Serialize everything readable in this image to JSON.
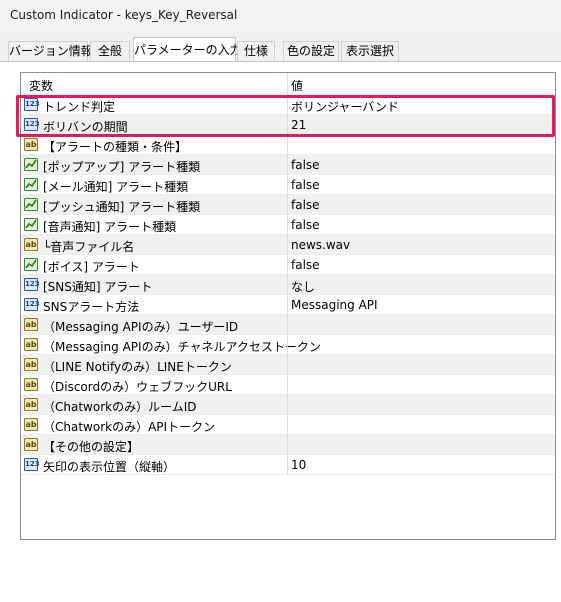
{
  "window": {
    "title": "Custom Indicator - keys_Key_Reversal"
  },
  "tabs": [
    {
      "label": "バージョン情報"
    },
    {
      "label": "全般"
    },
    {
      "label": "パラメーターの入力"
    },
    {
      "label": "仕様"
    },
    {
      "label": "色の設定"
    },
    {
      "label": "表示選択"
    }
  ],
  "grid": {
    "col_variable": "変数",
    "col_value": "値",
    "rows": [
      {
        "icon": "123",
        "type": "num",
        "name": "トレンド判定",
        "value": "ボリンジャーバンド"
      },
      {
        "icon": "123",
        "type": "num",
        "name": "ボリバンの期間",
        "value": "21"
      },
      {
        "icon": "ab",
        "type": "str",
        "name": "【アラートの種類・条件】",
        "value": ""
      },
      {
        "icon": "bool",
        "type": "bool",
        "name": "[ポップアップ] アラート種類",
        "value": "false"
      },
      {
        "icon": "bool",
        "type": "bool",
        "name": "[メール通知] アラート種類",
        "value": "false"
      },
      {
        "icon": "bool",
        "type": "bool",
        "name": "[プッシュ通知] アラート種類",
        "value": "false"
      },
      {
        "icon": "bool",
        "type": "bool",
        "name": "[音声通知] アラート種類",
        "value": "false"
      },
      {
        "icon": "ab",
        "type": "str",
        "name": "└音声ファイル名",
        "value": "news.wav"
      },
      {
        "icon": "bool",
        "type": "bool",
        "name": "[ボイス] アラート",
        "value": "false"
      },
      {
        "icon": "123",
        "type": "num",
        "name": "[SNS通知] アラート",
        "value": "なし"
      },
      {
        "icon": "123",
        "type": "num",
        "name": "SNSアラート方法",
        "value": "Messaging API"
      },
      {
        "icon": "ab",
        "type": "str",
        "name": "（Messaging APIのみ）ユーザーID",
        "value": ""
      },
      {
        "icon": "ab",
        "type": "str",
        "name": "（Messaging APIのみ）チャネルアクセストークン",
        "value": ""
      },
      {
        "icon": "ab",
        "type": "str",
        "name": "（LINE Notifyのみ）LINEトークン",
        "value": ""
      },
      {
        "icon": "ab",
        "type": "str",
        "name": "（Discordのみ）ウェブフックURL",
        "value": ""
      },
      {
        "icon": "ab",
        "type": "str",
        "name": "（Chatworkのみ）ルームID",
        "value": ""
      },
      {
        "icon": "ab",
        "type": "str",
        "name": "（Chatworkのみ）APIトークン",
        "value": ""
      },
      {
        "icon": "ab",
        "type": "str",
        "name": "【その他の設定】",
        "value": ""
      },
      {
        "icon": "123",
        "type": "num",
        "name": "矢印の表示位置（縦軸）",
        "value": "10"
      }
    ]
  },
  "colors": {
    "highlight": "#e8195a",
    "alt_row": "#f0f0f0"
  }
}
